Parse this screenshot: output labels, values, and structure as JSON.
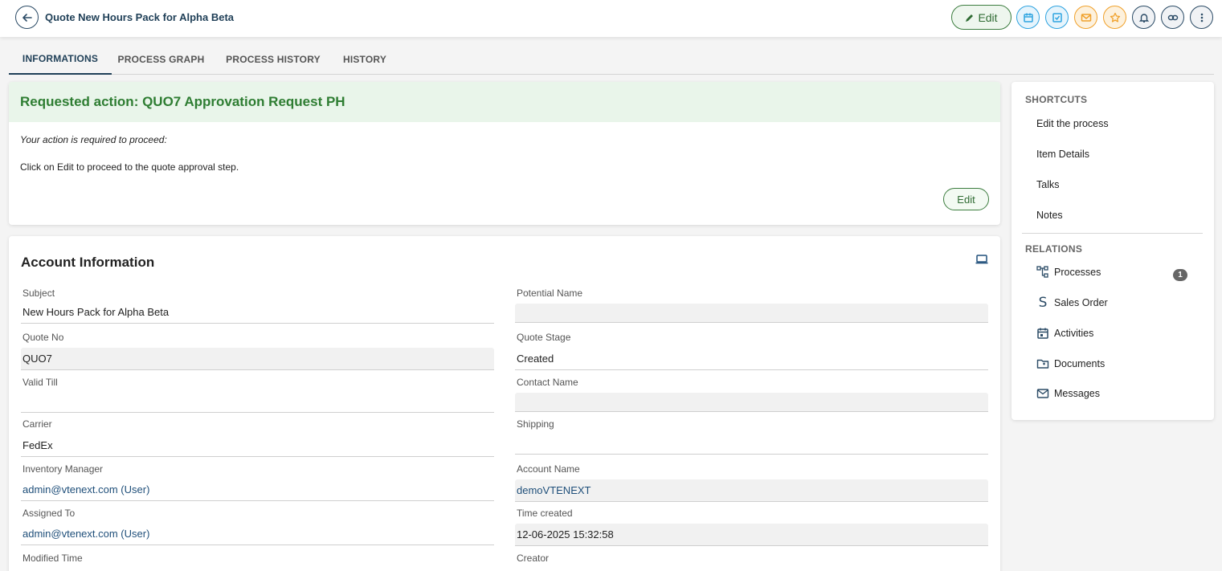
{
  "header": {
    "title": "Quote New Hours Pack for Alpha Beta",
    "edit_label": "Edit"
  },
  "tabs": [
    {
      "label": "INFORMATIONS"
    },
    {
      "label": "PROCESS GRAPH"
    },
    {
      "label": "PROCESS HISTORY"
    },
    {
      "label": "HISTORY"
    }
  ],
  "action": {
    "title": "Requested action: QUO7 Approvation Request PH",
    "intro": "Your action is required to proceed:",
    "text": "Click on Edit to proceed to the quote approval step.",
    "edit_label": "Edit"
  },
  "info": {
    "title": "Account Information",
    "fields": {
      "subject": {
        "label": "Subject",
        "value": "New Hours Pack for Alpha Beta"
      },
      "potential": {
        "label": "Potential Name",
        "value": ""
      },
      "quote_no": {
        "label": "Quote No",
        "value": "QUO7"
      },
      "quote_stage": {
        "label": "Quote Stage",
        "value": "Created"
      },
      "valid_till": {
        "label": "Valid Till",
        "value": ""
      },
      "contact": {
        "label": "Contact Name",
        "value": ""
      },
      "carrier": {
        "label": "Carrier",
        "value": "FedEx"
      },
      "shipping": {
        "label": "Shipping",
        "value": ""
      },
      "inventory_manager": {
        "label": "Inventory Manager",
        "value": "admin@vtenext.com (User)"
      },
      "account": {
        "label": "Account Name",
        "value": "demoVTENEXT"
      },
      "assigned_to": {
        "label": "Assigned To",
        "value": "admin@vtenext.com (User)"
      },
      "time_created": {
        "label": "Time created",
        "value": "12-06-2025 15:32:58"
      },
      "modified_time": {
        "label": "Modified Time",
        "value": ""
      },
      "creator": {
        "label": "Creator",
        "value": ""
      }
    }
  },
  "sidebar": {
    "shortcuts_title": "SHORTCUTS",
    "shortcuts": [
      {
        "label": "Edit the process"
      },
      {
        "label": "Item Details"
      },
      {
        "label": "Talks"
      },
      {
        "label": "Notes"
      }
    ],
    "relations_title": "RELATIONS",
    "relations": [
      {
        "label": "Processes",
        "icon": "processes-icon"
      },
      {
        "label": "Sales Order",
        "icon": "sales-order-icon"
      },
      {
        "label": "Activities",
        "icon": "calendar-icon"
      },
      {
        "label": "Documents",
        "icon": "folder-icon"
      },
      {
        "label": "Messages",
        "icon": "mail-icon"
      }
    ],
    "processes_count": "1"
  },
  "colors": {
    "accent": "#1f3f57",
    "success": "#2e7d32",
    "info_blue": "#2ea3e0",
    "warning": "#f0a12c"
  }
}
